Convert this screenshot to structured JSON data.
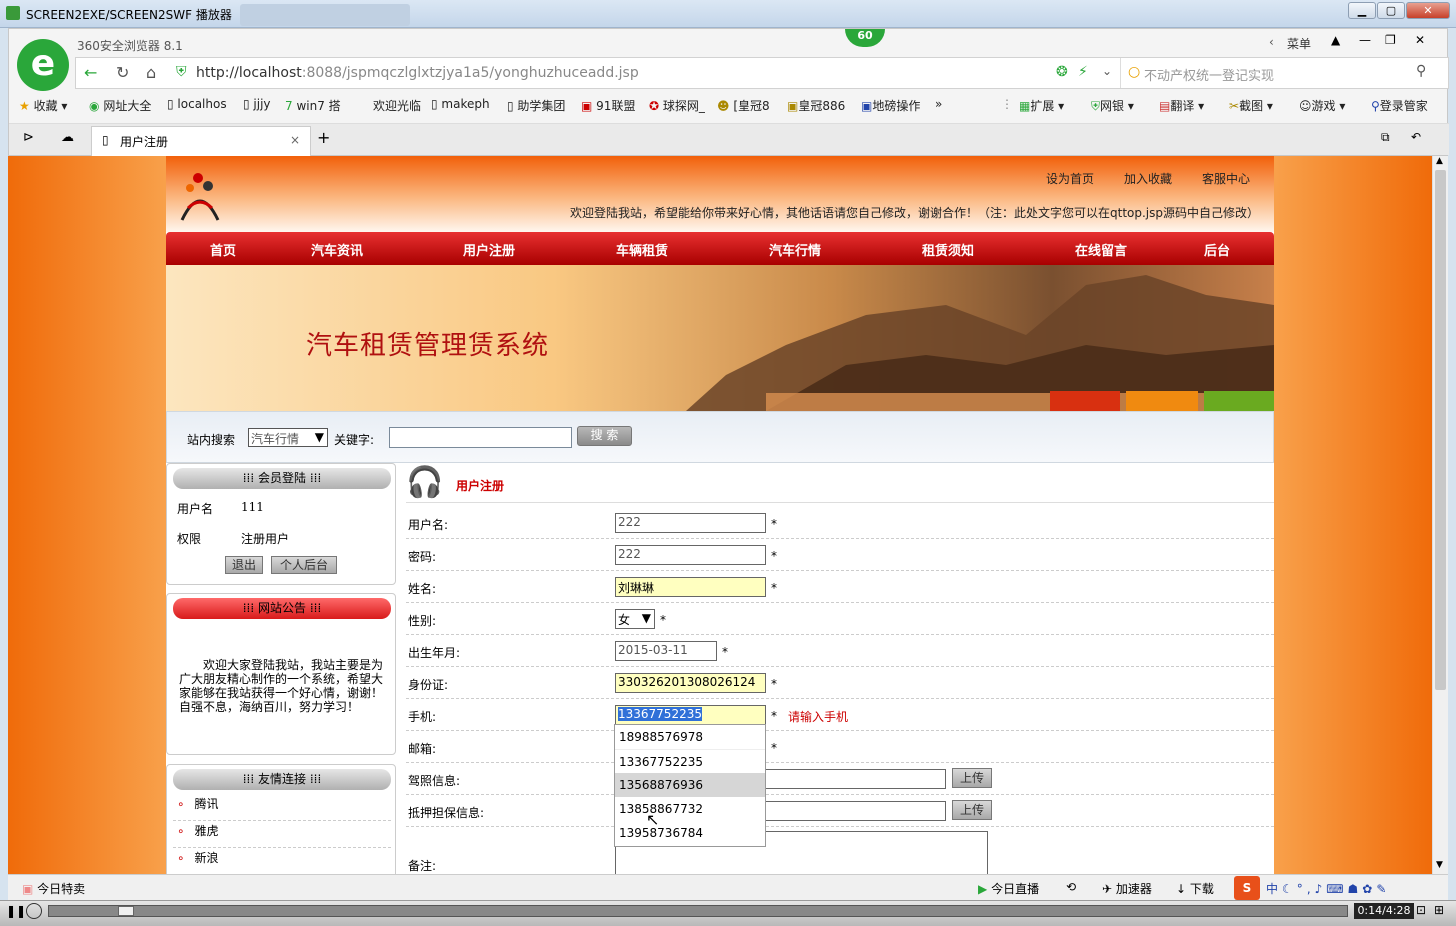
{
  "window": {
    "title": "SCREEN2EXE/SCREEN2SWF 播放器"
  },
  "browser": {
    "name": "360安全浏览器 8.1",
    "badge": "60",
    "menu": "菜单",
    "url_host": "http://localhost",
    "url_rest": ":8088/jspmqczlglxtzjya1a5/yonghuzhuceadd.jsp",
    "search_placeholder": "不动产权统一登记实现",
    "bookmarks": [
      "收藏",
      "网址大全",
      "localhos",
      "jjjy",
      "win7 搭",
      "欢迎光临",
      "makeph",
      "助学集团",
      "91联盟",
      "球探网_",
      "[皇冠8",
      "皇冠886",
      "地磅操作"
    ],
    "tools": [
      "扩展",
      "网银",
      "翻译",
      "截图",
      "游戏",
      "登录管家"
    ],
    "tab_title": "用户注册"
  },
  "site": {
    "top_links": [
      "设为首页",
      "加入收藏",
      "客服中心"
    ],
    "welcome": "欢迎登陆我站，希望能给你带来好心情，其他话语请您自己修改，谢谢合作！（注：此处文字您可以在qttop.jsp源码中自己修改）",
    "nav": [
      "首页",
      "汽车资讯",
      "用户注册",
      "车辆租赁",
      "汽车行情",
      "租赁须知",
      "在线留言",
      "后台"
    ],
    "banner_title": "汽车租赁管理赁系统",
    "search": {
      "label": "站内搜索",
      "select": "汽车行情",
      "kw_label": "关键字:",
      "button": "搜 索"
    },
    "login": {
      "title": "会员登陆",
      "user_label": "用户名",
      "user": "111",
      "role_label": "权限",
      "role": "注册用户",
      "logout": "退出",
      "backend": "个人后台"
    },
    "notice": {
      "title": "网站公告",
      "text": "欢迎大家登陆我站，我站主要是为广大朋友精心制作的一个系统，希望大家能够在我站获得一个好心情，谢谢！　　自强不息，海纳百川，努力学习！"
    },
    "links": {
      "title": "友情连接",
      "items": [
        "腾讯",
        "雅虎",
        "新浪"
      ]
    },
    "form": {
      "title": "用户注册",
      "fields": [
        {
          "label": "用户名:",
          "value": "222"
        },
        {
          "label": "密码:",
          "value": "222"
        },
        {
          "label": "姓名:",
          "value": "刘琳琳"
        },
        {
          "label": "性别:",
          "value": "女"
        },
        {
          "label": "出生年月:",
          "value": "2015-03-11"
        },
        {
          "label": "身份证:",
          "value": "330326201308026124"
        },
        {
          "label": "手机:",
          "value": "13367752235"
        },
        {
          "label": "邮箱:",
          "value": ""
        },
        {
          "label": "驾照信息:",
          "value": ""
        },
        {
          "label": "抵押担保信息:",
          "value": ""
        },
        {
          "label": "备注:",
          "value": ""
        }
      ],
      "star": "*",
      "phone_hint": "请输入手机",
      "upload": "上传",
      "autocomplete": [
        "18988576978",
        "13367752235",
        "13568876936",
        "13858867732",
        "13958736784"
      ]
    }
  },
  "status": {
    "left": "今日特卖",
    "live": "今日直播",
    "accel": "加速器",
    "download": "下载"
  },
  "player": {
    "time": "0:14/4:28"
  }
}
